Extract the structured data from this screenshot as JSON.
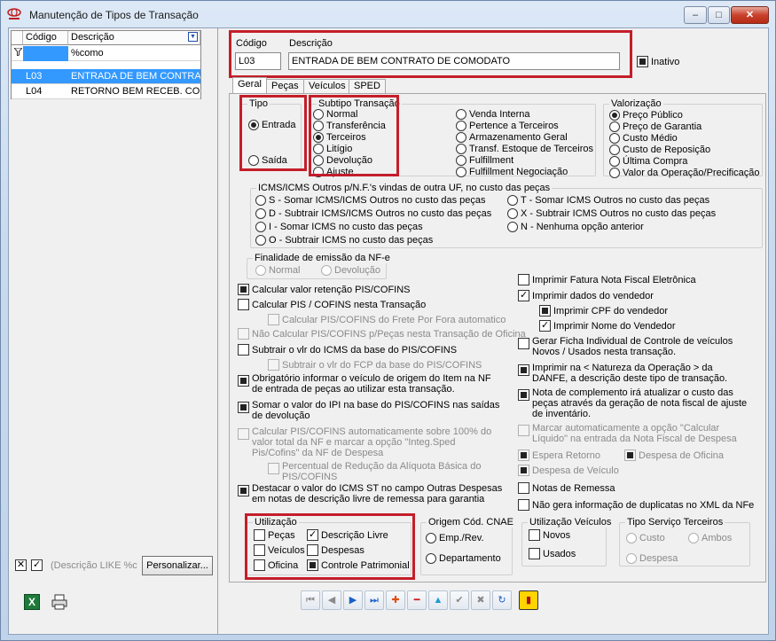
{
  "window": {
    "title": "Manutenção de Tipos de Transação",
    "minimize_glyph": "–",
    "maximize_glyph": "□",
    "close_glyph": "✕"
  },
  "grid": {
    "columns": [
      "Código",
      "Descrição"
    ],
    "filter_value": "%como",
    "rows": [
      {
        "codigo": "L03",
        "descricao": "ENTRADA DE BEM CONTRATO",
        "selected": true
      },
      {
        "codigo": "L04",
        "descricao": "RETORNO BEM RECEB. CONTR",
        "selected": false
      }
    ]
  },
  "filter_bar": {
    "text": "(Descrição LIKE %c",
    "customize_label": "Personalizar..."
  },
  "header": {
    "codigo_label": "Código",
    "codigo_value": "L03",
    "descricao_label": "Descrição",
    "descricao_value": "ENTRADA DE BEM CONTRATO DE COMODATO",
    "inativo_label": "Inativo"
  },
  "tabs": [
    "Geral",
    "Peças",
    "Veículos",
    "SPED"
  ],
  "tipo": {
    "title": "Tipo",
    "options": [
      "Entrada",
      "Saída"
    ],
    "selected": "Entrada"
  },
  "subtipo": {
    "title": "Subtipo Transação",
    "col1": [
      "Normal",
      "Transferência",
      "Terceiros",
      "Litígio",
      "Devolução",
      "Ajuste"
    ],
    "col2": [
      "Venda Interna",
      "Pertence a Terceiros",
      "Armazenamento Geral",
      "Transf. Estoque de Terceiros",
      "Fulfillment",
      "Fulfillment Negociação"
    ],
    "selected": "Terceiros"
  },
  "valorizacao": {
    "title": "Valorização",
    "options": [
      "Preço Público",
      "Preço de Garantia",
      "Custo Médio",
      "Custo de Reposição",
      "Última Compra",
      "Valor da Operação/Precificação"
    ],
    "selected": "Preço Público"
  },
  "icms": {
    "title": "ICMS/ICMS Outros p/N.F.'s vindas de outra UF, no custo das peças",
    "col1": [
      "S - Somar ICMS/ICMS Outros no custo das peças",
      "D - Subtrair ICMS/ICMS Outros no custo das peças",
      "I - Somar ICMS no custo das peças",
      "O - Subtrair ICMS no custo das peças"
    ],
    "col2": [
      "T - Somar ICMS Outros no custo das peças",
      "X - Subtrair ICMS Outros no custo das peças",
      "N - Nenhuma opção anterior"
    ]
  },
  "finalidade": {
    "title": "Finalidade de emissão da NF-e",
    "options": [
      "Normal",
      "Devolução"
    ]
  },
  "left_checks": {
    "calc_ret_pis": "Calcular valor retenção PIS/COFINS",
    "calc_pis_nesta": "Calcular PIS / COFINS nesta Transação",
    "calc_pis_frete": "Calcular PIS/COFINS do Frete Por Fora automatico",
    "nao_calc_pis": "Não Calcular PIS/COFINS p/Peças nesta Transação de Oficina",
    "subtrair_icms": "Subtrair o vlr do ICMS da base do PIS/COFINS",
    "subtrair_fcp": "Subtrair o vlr do FCP da base do PIS/COFINS",
    "obrigatorio": "Obrigatório informar o veículo de origem do Item na NF de entrada de peças ao utilizar esta transação.",
    "somar_ipi": "Somar o valor do IPI na base do PIS/COFINS nas saídas de devolução",
    "calc_pis_auto": "Calcular PIS/COFINS automaticamente sobre 100% do valor total da NF e marcar a opção \"Integ.Sped Pis/Cofins\" da NF de Despesa",
    "percentual": "Percentual de Redução da Alíquota Básica do PIS/COFINS",
    "destacar_icms": "Destacar o valor do ICMS ST no campo Outras Despesas em notas de descrição livre de remessa para garantia"
  },
  "right_checks": {
    "imprimir_fatura": "Imprimir Fatura Nota Fiscal Eletrônica",
    "imprimir_vendedor": "Imprimir dados do vendedor",
    "imprimir_cpf": "Imprimir CPF do vendedor",
    "imprimir_nome": "Imprimir Nome do Vendedor",
    "gerar_ficha": "Gerar Ficha Individual de Controle de veículos Novos / Usados  nesta transação.",
    "imprimir_natureza": "Imprimir na < Natureza da Operação > da DANFE, a descrição deste tipo de transação.",
    "nota_complemento": "Nota de complemento irá atualizar o custo das peças através da geração de nota fiscal de ajuste de inventário.",
    "marcar_auto": "Marcar automaticamente a opção \"Calcular Líquido\" na entrada da Nota Fiscal de Despesa",
    "espera_retorno": "Espera Retorno",
    "despesa_oficina": "Despesa de Oficina",
    "despesa_veiculo": "Despesa de Veículo",
    "notas_remessa": "Notas de Remessa",
    "nao_gera_dup": "Não gera informação de duplicatas no XML da NFe"
  },
  "utilizacao": {
    "title": "Utilização",
    "items": [
      "Peças",
      "Descrição Livre",
      "Veículos",
      "Despesas",
      "Oficina",
      "Controle Patrimonial"
    ]
  },
  "origem": {
    "title": "Origem Cód. CNAE",
    "options": [
      "Emp./Rev.",
      "Departamento"
    ]
  },
  "util_veiculos": {
    "title": "Utilização Veículos",
    "options": [
      "Novos",
      "Usados"
    ]
  },
  "tipo_servico": {
    "title": "Tipo Serviço Terceiros",
    "options": [
      "Custo",
      "Ambos",
      "Despesa"
    ]
  },
  "toolbar": {
    "icons": [
      "first-icon",
      "prev-icon",
      "next-icon",
      "last-icon",
      "add-icon",
      "delete-icon",
      "up-icon",
      "confirm-icon",
      "cancel-icon",
      "refresh-icon",
      "exit-icon"
    ],
    "glyphs": [
      "⏮",
      "◀",
      "▶",
      "⏭",
      "✚",
      "━",
      "▲",
      "✔",
      "✖",
      "↻",
      "▮"
    ]
  },
  "colors": {
    "highlight": "#c41e2a",
    "selection": "#3399ff",
    "nav_blue": "#1a5fc4"
  }
}
